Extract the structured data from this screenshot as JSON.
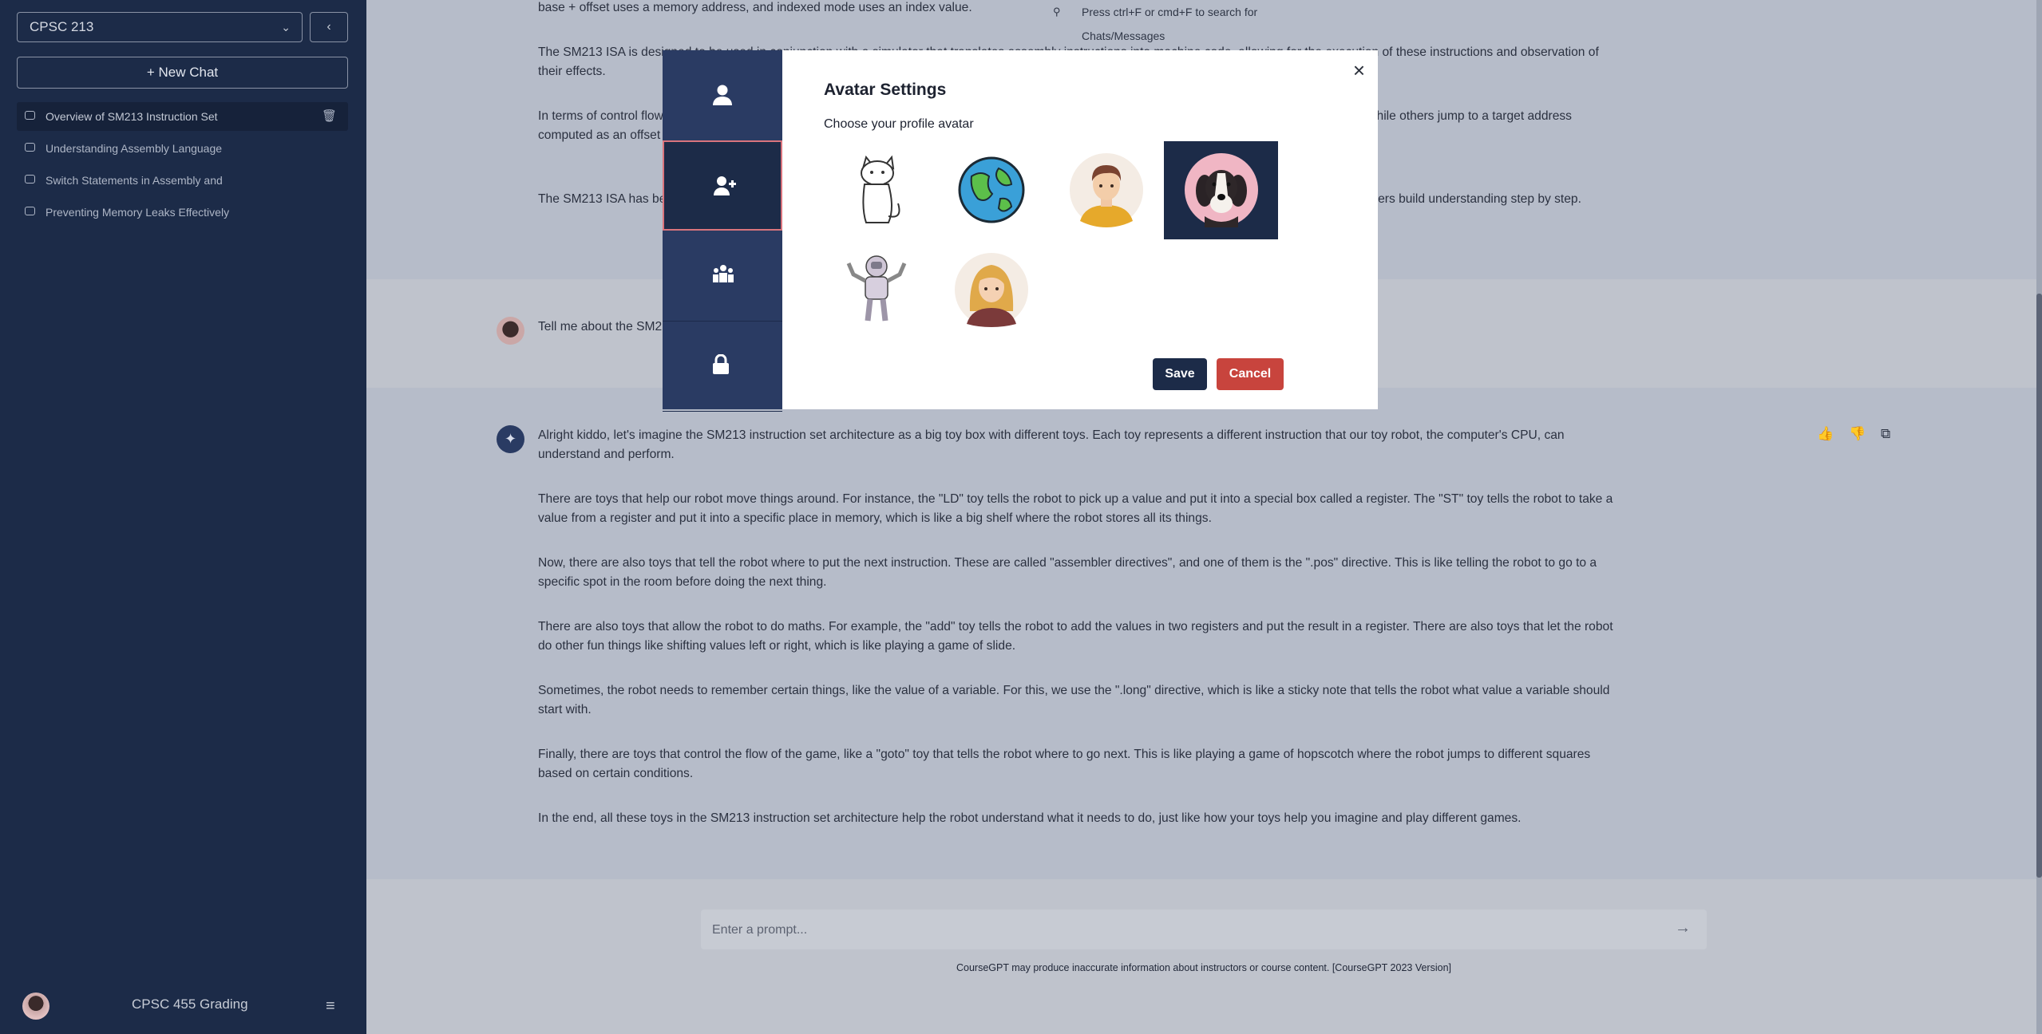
{
  "sidebar": {
    "course": "CPSC 213",
    "collapse_icon": "chevron-left-icon",
    "new_chat": "+ New Chat",
    "chats": [
      {
        "label": "Overview of SM213 Instruction Set",
        "active": true
      },
      {
        "label": "Understanding Assembly Language",
        "active": false
      },
      {
        "label": "Switch Statements in Assembly and",
        "active": false
      },
      {
        "label": "Preventing Memory Leaks Effectively",
        "active": false
      }
    ],
    "user_name": "CPSC 455 Grading"
  },
  "search_hint": "Press ctrl+F or cmd+F to search for Chats/Messages",
  "conversation": {
    "partial_paragraphs": [
      "base + offset uses a memory address, and indexed mode uses an index value.",
      "The SM213 ISA is designed to be used in conjunction with a simulator that translates assembly instructions into machine code, allowing for the execution of these instructions and observation of their effects.",
      "In terms of control flow, the ISA supports unconditional and conditional jumps. Some jump only if a condition holds, for example, if a register value is 0, while others jump to a target address computed as an offset added to the current program counter value.",
      "The SM213 ISA has been designed for teaching, so students can explore the instruction set in a progression of code snippets. This approach helps learners build understanding step by step."
    ],
    "user_message": "Tell me about the SM213 instruction set like I'm 5.",
    "assistant_paragraphs": [
      "Alright kiddo, let's imagine the SM213 instruction set architecture as a big toy box with different toys. Each toy represents a different instruction that our toy robot, the computer's CPU, can understand and perform.",
      "There are toys that help our robot move things around. For instance, the \"LD\" toy tells the robot to pick up a value and put it into a special box called a register. The \"ST\" toy tells the robot to take a value from a register and put it into a specific place in memory, which is like a big shelf where the robot stores all its things.",
      "Now, there are also toys that tell the robot where to put the next instruction. These are called \"assembler directives\", and one of them is the \".pos\" directive. This is like telling the robot to go to a specific spot in the room before doing the next thing.",
      "There are also toys that allow the robot to do maths. For example, the \"add\" toy tells the robot to add the values in two registers and put the result in a register. There are also toys that let the robot do other fun things like shifting values left or right, which is like playing a game of slide.",
      "Sometimes, the robot needs to remember certain things, like the value of a variable. For this, we use the \".long\" directive, which is like a sticky note that tells the robot what value a variable should start with.",
      "Finally, there are toys that control the flow of the game, like a \"goto\" toy that tells the robot where to go next. This is like playing a game of hopscotch where the robot jumps to different squares based on certain conditions.",
      "In the end, all these toys in the SM213 instruction set architecture help the robot understand what it needs to do, just like how your toys help you imagine and play different games."
    ],
    "actions": [
      "thumbs-up-icon",
      "thumbs-down-icon",
      "copy-icon"
    ]
  },
  "prompt": {
    "placeholder": "Enter a prompt..."
  },
  "disclaimer": "CourseGPT may produce inaccurate information about instructors or course content. [CourseGPT 2023 Version]",
  "modal": {
    "title": "Avatar Settings",
    "subtitle": "Choose your profile avatar",
    "tabs": [
      "user-icon",
      "user-plus-icon",
      "user-group-icon",
      "lock-icon"
    ],
    "active_tab": 1,
    "avatars": [
      "cat-avatar",
      "earth-avatar",
      "man-avatar",
      "dog-avatar",
      "astronaut-avatar",
      "woman-avatar"
    ],
    "selected_avatar": "dog-avatar",
    "save": "Save",
    "cancel": "Cancel"
  },
  "colors": {
    "sidebar": "#1c2b48",
    "primary_button": "#1c2b48",
    "cancel_button": "#c8443d",
    "active_tab_border": "#d9747d"
  }
}
